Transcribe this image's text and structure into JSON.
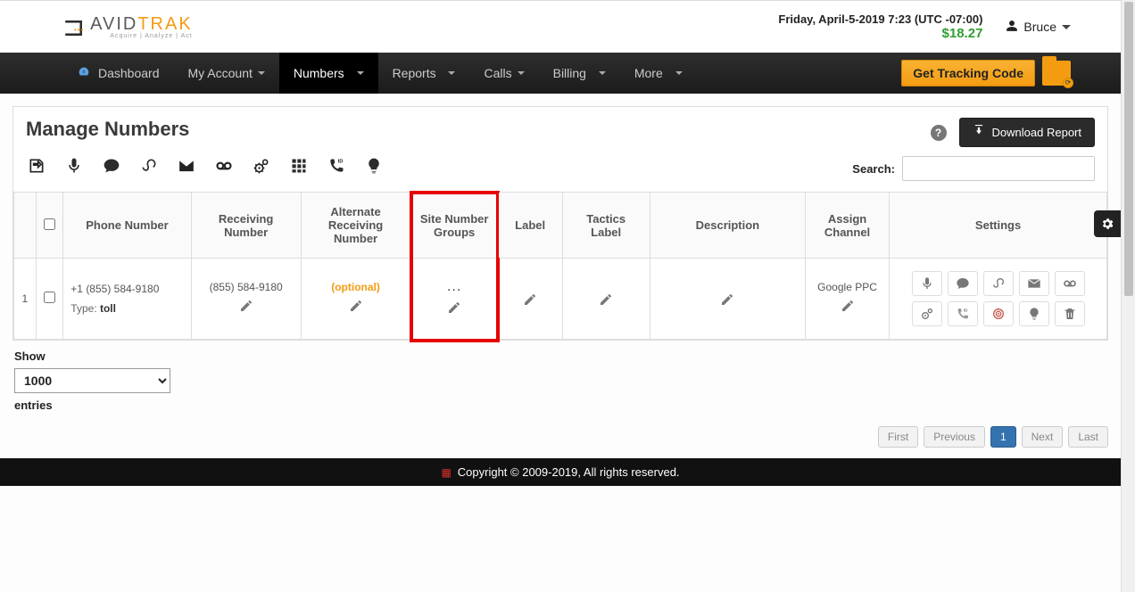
{
  "logo": {
    "text_main": "AVID",
    "text_accent": "TRAK",
    "subtext": "Acquire | Analyze | Act"
  },
  "header": {
    "datetime": "Friday, April-5-2019 7:23 (UTC -07:00)",
    "balance": "$18.27",
    "user_name": "Bruce"
  },
  "nav": {
    "dashboard": "Dashboard",
    "my_account": "My Account",
    "numbers": "Numbers",
    "reports": "Reports",
    "calls": "Calls",
    "billing": "Billing",
    "more": "More",
    "tracking_code_btn": "Get Tracking Code"
  },
  "page": {
    "title": "Manage Numbers",
    "download_btn": "Download Report",
    "search_label": "Search:"
  },
  "table": {
    "headers": {
      "phone_number": "Phone Number",
      "receiving_number": "Receiving Number",
      "alternate_receiving": "Alternate Receiving Number",
      "site_groups": "Site Number Groups",
      "label": "Label",
      "tactics_label": "Tactics Label",
      "description": "Description",
      "assign_channel": "Assign Channel",
      "settings": "Settings"
    },
    "rows": [
      {
        "index": "1",
        "phone_number": "+1 (855) 584-9180",
        "type_label": "Type: ",
        "phone_type": "toll",
        "receiving_number": "(855) 584-9180",
        "alternate": "(optional)",
        "site_groups": "...",
        "label": "",
        "tactics": "",
        "description": "",
        "channel": "Google PPC"
      }
    ]
  },
  "controls": {
    "show_label": "Show",
    "entries_value": "1000",
    "entries_label": "entries"
  },
  "pagination": {
    "first": "First",
    "previous": "Previous",
    "page": "1",
    "next": "Next",
    "last": "Last"
  },
  "footer": {
    "text": "Copyright © 2009-2019, All rights reserved."
  }
}
